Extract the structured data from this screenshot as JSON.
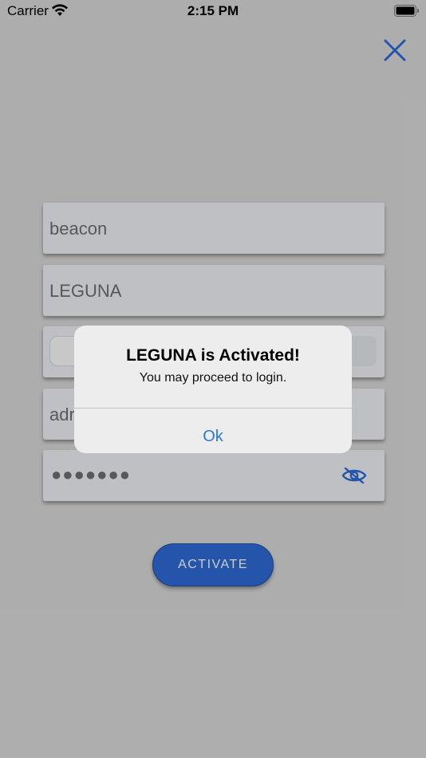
{
  "status_bar": {
    "carrier": "Carrier",
    "time": "2:15 PM"
  },
  "form": {
    "username_value": "beacon",
    "site_value": "LEGUNA",
    "user_value_partial": "adr",
    "password_masked": "●●●●●●●",
    "activate_label": "ACTIVATE"
  },
  "alert": {
    "title": "LEGUNA is Activated!",
    "message": "You may proceed to login.",
    "ok_label": "Ok"
  },
  "colors": {
    "accent": "#2d6bd6",
    "link": "#2a77e5",
    "background": "#d9d9d9"
  },
  "icons": {
    "close": "close-icon",
    "eye": "eye-slash-icon",
    "wifi": "wifi-icon",
    "battery": "battery-icon"
  }
}
